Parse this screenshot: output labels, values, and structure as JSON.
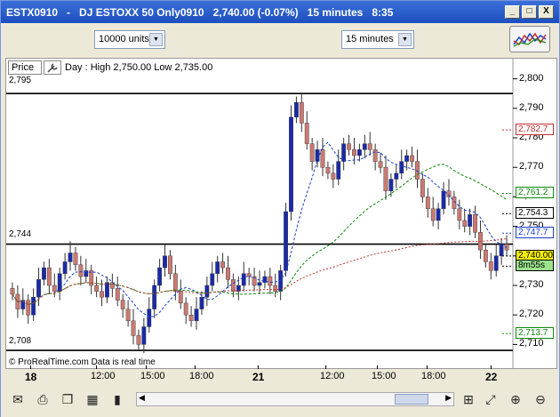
{
  "window": {
    "symbol": "ESTX0910",
    "name": "DJ ESTOXX 50 Only0910",
    "quote": "2,740.00 (-0.07%)",
    "interval": "15 minutes",
    "time": "8:35",
    "buttons": {
      "minimize": "_",
      "maximize": "□",
      "close": "X"
    }
  },
  "toolbar": {
    "units_select": "10000 units",
    "interval_select": "15 minutes",
    "indicators_icon": "indicators-icon"
  },
  "chart": {
    "price_tab": "Price",
    "day_info": "Day : High 2,750.00 Low 2,735.00",
    "level_labels": [
      "2,795",
      "2,744",
      "2,708"
    ],
    "status": "© ProRealTime.com  Data is real time",
    "y_ticks": [
      "2,800",
      "2,790",
      "2,780",
      "2,770",
      "2,760",
      "2,750",
      "2,740",
      "2,730",
      "2,720",
      "2,710"
    ],
    "price_labels": [
      {
        "text": "2,782.7",
        "color": "#c03030"
      },
      {
        "text": "2,761.2",
        "color": "#0a8a0a"
      },
      {
        "text": "2,754.3",
        "color": "#000000"
      },
      {
        "text": "2,747.7",
        "color": "#1a3fd0"
      },
      {
        "text": "2,740.00",
        "color": "#000000",
        "bg": "#f6f000"
      },
      {
        "text": "8m55s",
        "color": "#000000",
        "bg": "#9be28b"
      },
      {
        "text": "2,713.7",
        "color": "#0a8a0a"
      }
    ],
    "x_labels": [
      "18",
      "12:00",
      "15:00",
      "18:00",
      "21",
      "12:00",
      "15:00",
      "18:00",
      "22"
    ]
  },
  "chart_data": {
    "type": "candlestick",
    "title": "ESTX0910 - DJ ESTOXX 50 Only0910",
    "interval": "15 minutes",
    "ylim": [
      2705,
      2802
    ],
    "horizontal_levels": [
      2795,
      2744,
      2708
    ],
    "closes": [
      2727,
      2722,
      2725,
      2720,
      2726,
      2732,
      2736,
      2730,
      2728,
      2734,
      2738,
      2741,
      2737,
      2733,
      2735,
      2730,
      2728,
      2726,
      2731,
      2729,
      2725,
      2722,
      2718,
      2713,
      2710,
      2716,
      2722,
      2730,
      2736,
      2740,
      2734,
      2728,
      2724,
      2720,
      2718,
      2722,
      2726,
      2730,
      2734,
      2738,
      2736,
      2732,
      2728,
      2730,
      2734,
      2733,
      2730,
      2731,
      2733,
      2730,
      2728,
      2735,
      2755,
      2787,
      2792,
      2785,
      2778,
      2772,
      2776,
      2770,
      2768,
      2766,
      2772,
      2778,
      2776,
      2774,
      2776,
      2778,
      2776,
      2772,
      2770,
      2762,
      2766,
      2768,
      2772,
      2774,
      2772,
      2766,
      2760,
      2756,
      2752,
      2756,
      2762,
      2760,
      2756,
      2752,
      2750,
      2754,
      2748,
      2742,
      2738,
      2735,
      2740,
      2744,
      2742
    ],
    "indicators": [
      {
        "name": "2,782.7",
        "color": "#c03030",
        "last": 2782.7
      },
      {
        "name": "2,761.2",
        "color": "#0a8a0a",
        "last": 2761.2
      },
      {
        "name": "2,747.7",
        "color": "#1a3fd0",
        "last": 2747.7
      },
      {
        "name": "2,713.7",
        "color": "#0a8a0a",
        "last": 2713.7
      }
    ]
  },
  "bottombar": {
    "icons": [
      "mail-icon",
      "print-icon",
      "copy-icon",
      "grid-icon",
      "bar-chart-icon",
      "candle-chart-icon",
      "settings-icon",
      "zoom-fit-icon",
      "zoom-in-icon",
      "zoom-out-icon"
    ]
  }
}
